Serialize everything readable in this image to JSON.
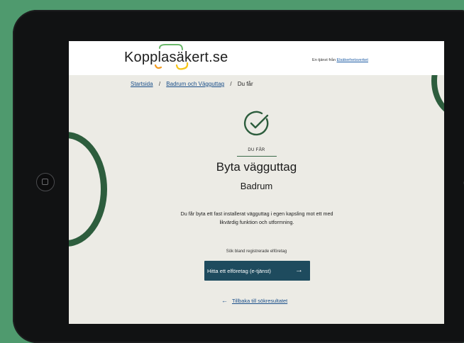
{
  "header": {
    "logo_text": "Kopplasäkert.se",
    "partner_prefix": "En tjänst från ",
    "partner_link": "Elsäkerhetsverket"
  },
  "breadcrumb": {
    "items": [
      "Startsida",
      "Badrum och Vägguttag",
      "Du får"
    ],
    "separator": "/"
  },
  "result": {
    "eyebrow": "DU FÅR",
    "title": "Byta vägguttag",
    "subtitle": "Badrum",
    "description": "Du får byta ett fast installerat vägguttag i egen kapsling mot ett med likvärdig funktion och utformning."
  },
  "search": {
    "label": "Sök bland registrerade elföretag",
    "button_label": "Hitta ett elföretag (e-tjänst)",
    "button_arrow": "→"
  },
  "back": {
    "arrow": "←",
    "label": "Tillbaka till sökresultatet"
  },
  "colors": {
    "brand_green": "#2d5d3d",
    "button_bg": "#1e4b5e",
    "page_bg": "#ecebe5",
    "link": "#1a4f8a"
  },
  "icons": {
    "status": "check-circle-icon",
    "button": "arrow-right-icon",
    "back": "arrow-left-icon"
  }
}
